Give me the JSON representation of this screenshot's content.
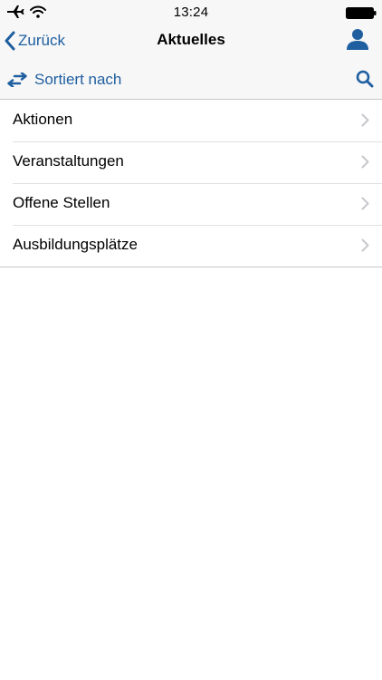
{
  "status_bar": {
    "time": "13:24",
    "icons": [
      "airplane-icon",
      "wifi-icon",
      "battery-icon"
    ]
  },
  "nav_bar": {
    "back_label": "Zurück",
    "title": "Aktuelles",
    "user_icon": "user-icon"
  },
  "toolbar": {
    "sort_label": "Sortiert nach",
    "sort_icon": "swap-arrows-icon",
    "search_icon": "search-icon"
  },
  "list": {
    "items": [
      {
        "label": "Aktionen"
      },
      {
        "label": "Veranstaltungen"
      },
      {
        "label": "Offene Stellen"
      },
      {
        "label": "Ausbildungsplätze"
      }
    ]
  },
  "colors": {
    "accent": "#1f5fa0",
    "bar_background": "#f7f7f7",
    "separator": "#c8c7cc",
    "chevron": "#c7c7cc"
  }
}
